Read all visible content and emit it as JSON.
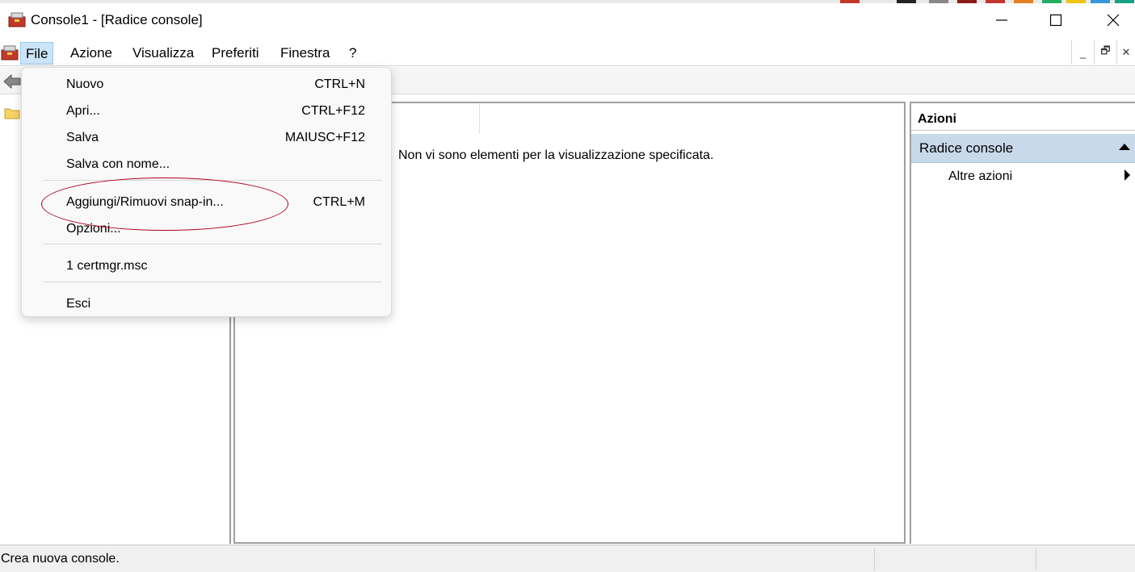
{
  "window": {
    "title": "Console1 - [Radice console]"
  },
  "menubar": {
    "items": [
      {
        "label": "File"
      },
      {
        "label": "Azione"
      },
      {
        "label": "Visualizza"
      },
      {
        "label": "Preferiti"
      },
      {
        "label": "Finestra"
      },
      {
        "label": "?"
      }
    ]
  },
  "file_menu": {
    "items": [
      {
        "label": "Nuovo",
        "shortcut": "CTRL+N"
      },
      {
        "label": "Apri...",
        "shortcut": "CTRL+F12"
      },
      {
        "label": "Salva",
        "shortcut": ""
      },
      {
        "label": "Salva con nome...",
        "shortcut": "MAIUSC+F12"
      },
      {
        "label": "Aggiungi/Rimuovi snap-in...",
        "shortcut": "CTRL+M"
      },
      {
        "label": "Opzioni...",
        "shortcut": ""
      },
      {
        "label": "1 certmgr.msc",
        "shortcut": ""
      },
      {
        "label": "Esci",
        "shortcut": ""
      }
    ]
  },
  "center": {
    "empty_message": "Non vi sono elementi per la visualizzazione specificata."
  },
  "actions": {
    "title": "Azioni",
    "section": "Radice console",
    "items": [
      {
        "label": "Altre azioni"
      }
    ]
  },
  "statusbar": {
    "text": "Crea nuova console."
  },
  "colors": {
    "menu_active_bg": "#cce4f7",
    "actions_section_bg": "#c9d9ec",
    "highlight_ellipse": "#b00020"
  }
}
